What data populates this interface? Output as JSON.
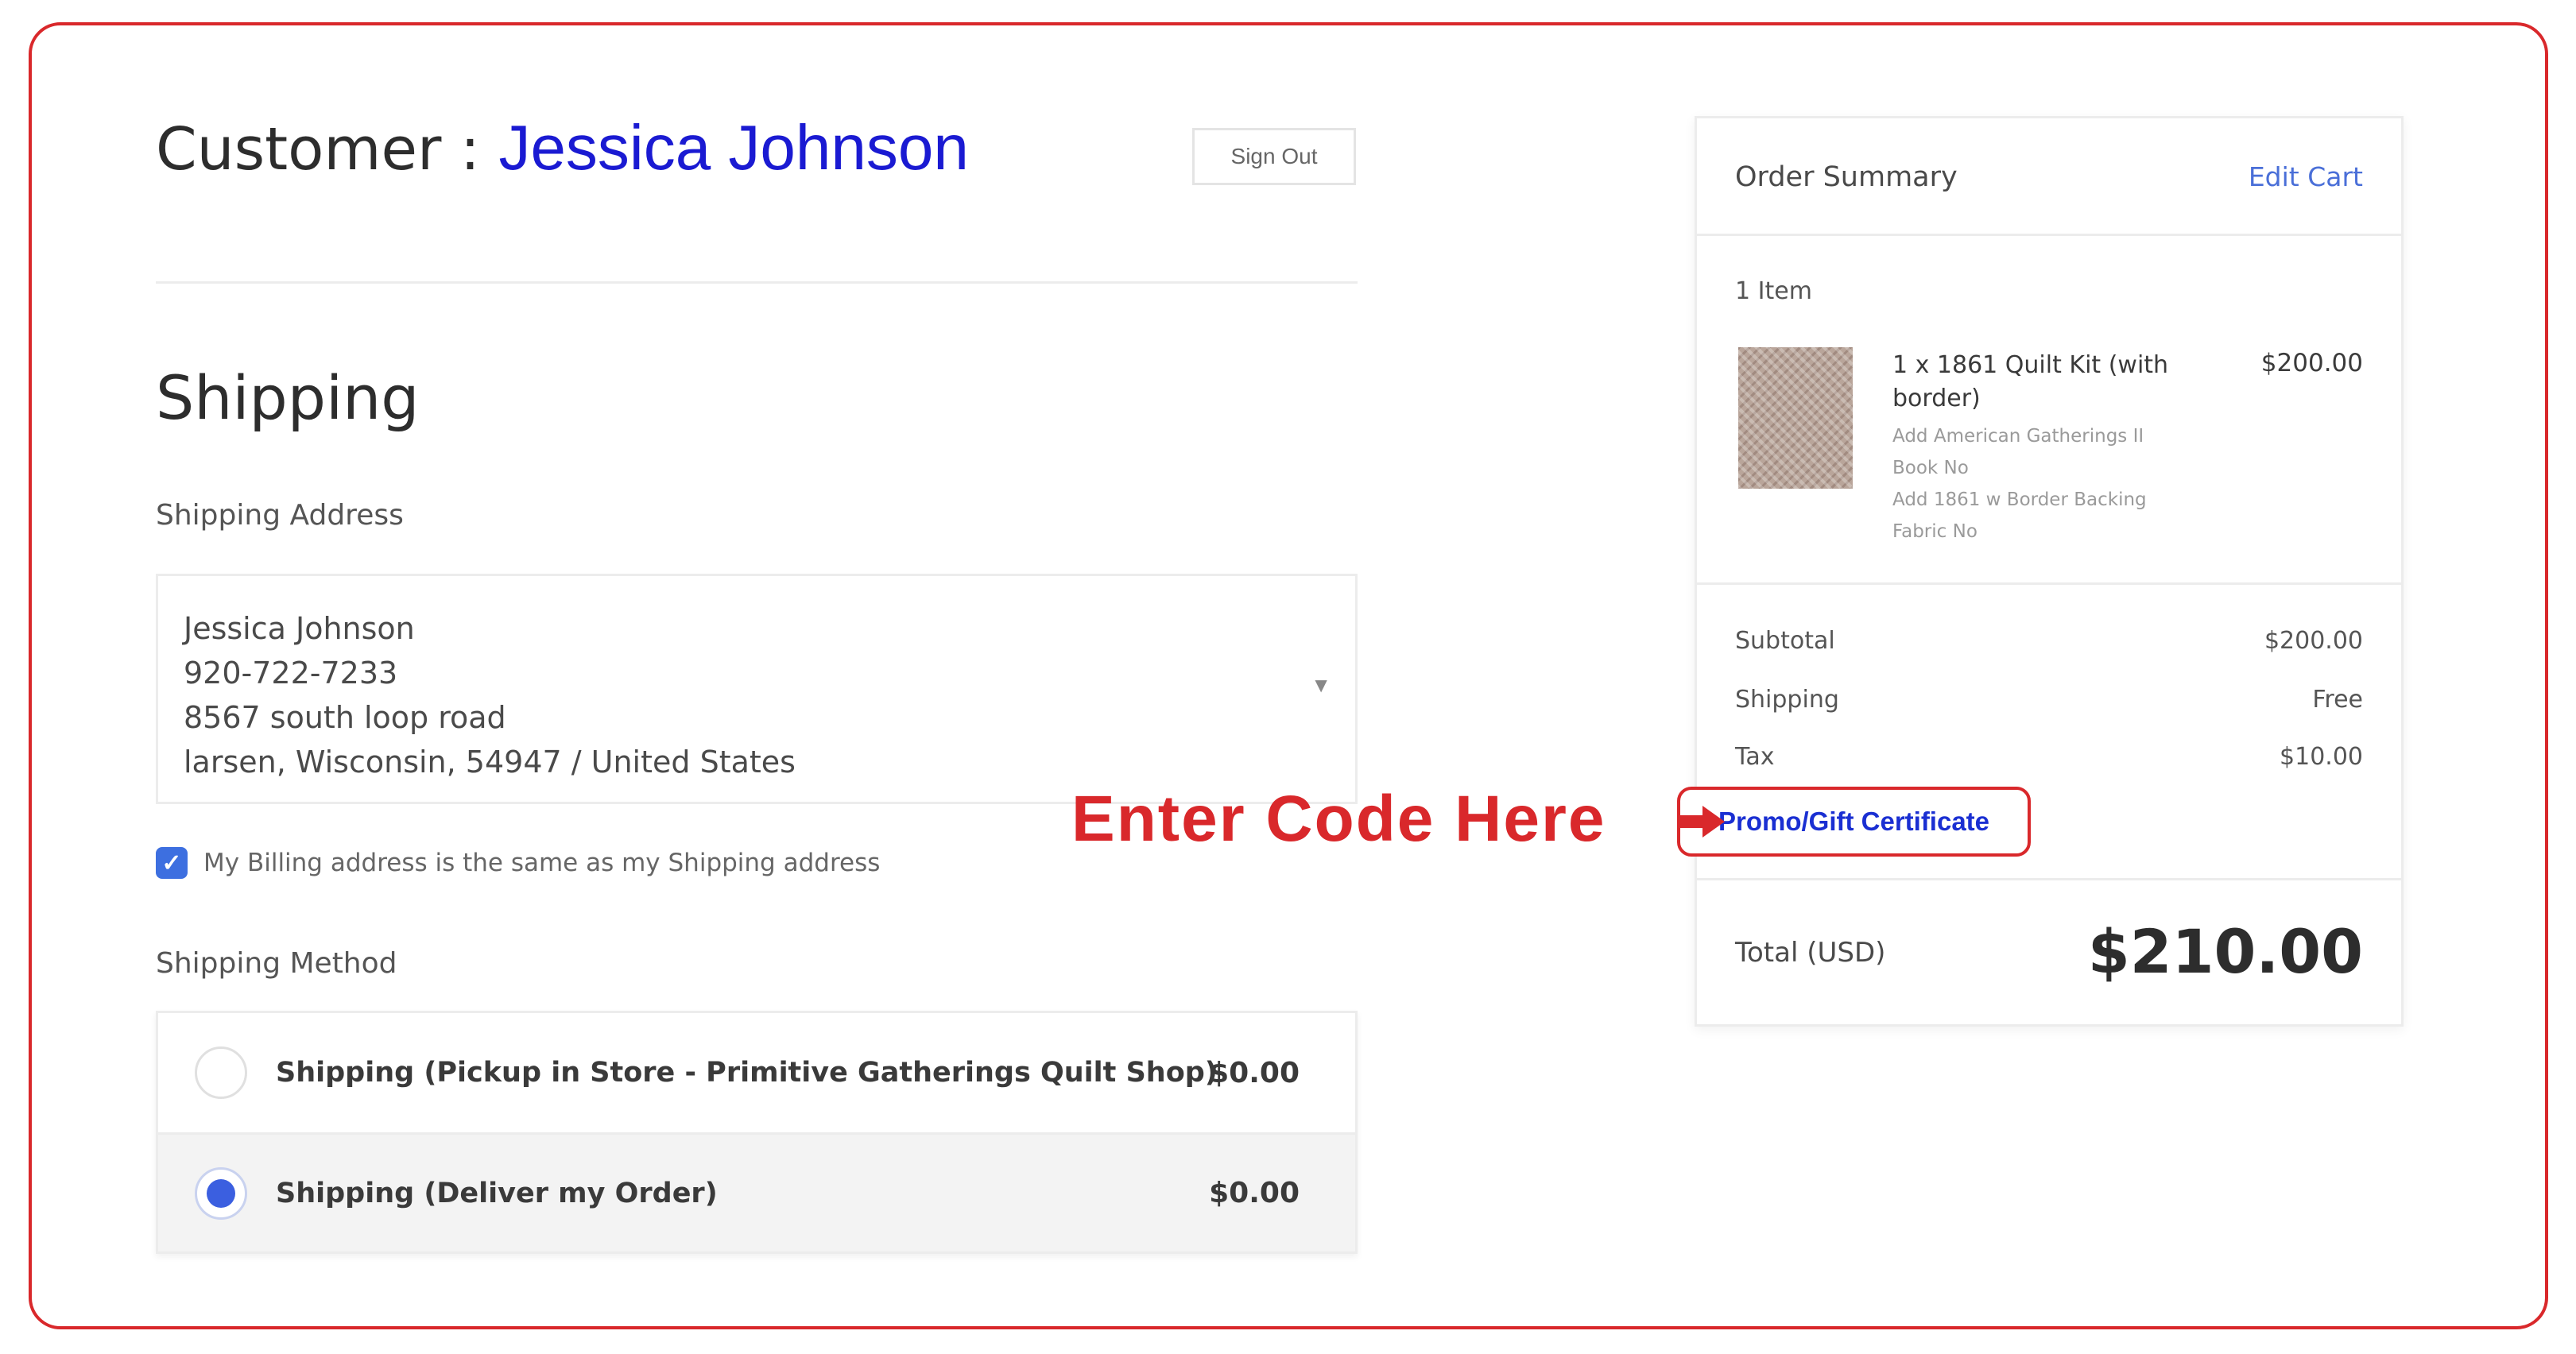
{
  "customer": {
    "label": "Customer : ",
    "name": "Jessica Johnson",
    "sign_out_label": "Sign Out"
  },
  "shipping": {
    "heading": "Shipping",
    "address_label": "Shipping Address",
    "address": {
      "name": "Jessica Johnson",
      "phone": "920-722-7233",
      "street": "8567 south loop road",
      "city_line": "larsen, Wisconsin, 54947 / United States"
    },
    "billing_same_label": "My Billing address is the same as my Shipping address",
    "billing_same_checked": true,
    "method_label": "Shipping Method",
    "methods": [
      {
        "label": "Shipping (Pickup in Store - Primitive Gatherings Quilt Shop)",
        "price": "$0.00",
        "selected": false
      },
      {
        "label": "Shipping (Deliver my Order)",
        "price": "$0.00",
        "selected": true
      }
    ]
  },
  "order_summary": {
    "title": "Order Summary",
    "edit_cart_label": "Edit Cart",
    "items_count": "1 Item",
    "item": {
      "name": "1 x 1861 Quilt Kit (with border)",
      "options": [
        "Add American Gatherings II",
        "Book No",
        "Add 1861 w Border Backing",
        "Fabric No"
      ],
      "price": "$200.00"
    },
    "subtotal_label": "Subtotal",
    "subtotal_value": "$200.00",
    "shipping_label": "Shipping",
    "shipping_value": "Free",
    "tax_label": "Tax",
    "tax_value": "$10.00",
    "promo_label": "Promo/Gift Certificate",
    "total_label": "Total (USD)",
    "total_value": "$210.00"
  },
  "annotation": {
    "text": "Enter Code Here"
  },
  "colors": {
    "accent_red": "#d9282b",
    "customer_name_blue": "#1a1ad2",
    "link_blue": "#4a6fd8",
    "radio_blue": "#3b5fe0"
  }
}
